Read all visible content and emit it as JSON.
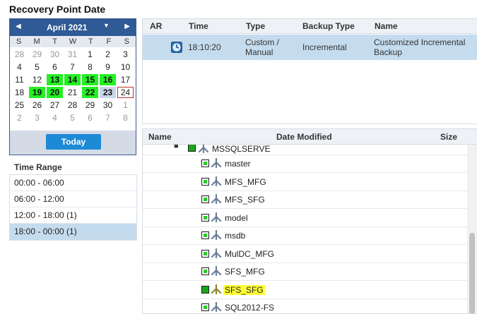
{
  "title": "Recovery Point Date",
  "calendar": {
    "month_label": "April 2021",
    "prev_icon": "chevron-left-icon",
    "next_icon": "chevron-right-icon",
    "weekdays": [
      "S",
      "M",
      "T",
      "W",
      "T",
      "F",
      "S"
    ],
    "days": [
      {
        "d": "28",
        "kind": "other"
      },
      {
        "d": "29",
        "kind": "other"
      },
      {
        "d": "30",
        "kind": "other"
      },
      {
        "d": "31",
        "kind": "other"
      },
      {
        "d": "1",
        "kind": ""
      },
      {
        "d": "2",
        "kind": ""
      },
      {
        "d": "3",
        "kind": ""
      },
      {
        "d": "4",
        "kind": ""
      },
      {
        "d": "5",
        "kind": ""
      },
      {
        "d": "6",
        "kind": ""
      },
      {
        "d": "7",
        "kind": ""
      },
      {
        "d": "8",
        "kind": ""
      },
      {
        "d": "9",
        "kind": ""
      },
      {
        "d": "10",
        "kind": ""
      },
      {
        "d": "11",
        "kind": ""
      },
      {
        "d": "12",
        "kind": ""
      },
      {
        "d": "13",
        "kind": "backup"
      },
      {
        "d": "14",
        "kind": "backup"
      },
      {
        "d": "15",
        "kind": "backup"
      },
      {
        "d": "16",
        "kind": "backup"
      },
      {
        "d": "17",
        "kind": ""
      },
      {
        "d": "18",
        "kind": ""
      },
      {
        "d": "19",
        "kind": "backup"
      },
      {
        "d": "20",
        "kind": "backup"
      },
      {
        "d": "21",
        "kind": ""
      },
      {
        "d": "22",
        "kind": "backup"
      },
      {
        "d": "23",
        "kind": "selected"
      },
      {
        "d": "24",
        "kind": "today"
      },
      {
        "d": "25",
        "kind": ""
      },
      {
        "d": "26",
        "kind": ""
      },
      {
        "d": "27",
        "kind": ""
      },
      {
        "d": "28",
        "kind": ""
      },
      {
        "d": "29",
        "kind": ""
      },
      {
        "d": "30",
        "kind": ""
      },
      {
        "d": "1",
        "kind": "other"
      },
      {
        "d": "2",
        "kind": "other"
      },
      {
        "d": "3",
        "kind": "other"
      },
      {
        "d": "4",
        "kind": "other"
      },
      {
        "d": "5",
        "kind": "other"
      },
      {
        "d": "6",
        "kind": "other"
      },
      {
        "d": "7",
        "kind": "other"
      },
      {
        "d": "8",
        "kind": "other"
      }
    ],
    "today_label": "Today"
  },
  "time_range": {
    "title": "Time Range",
    "items": [
      {
        "label": "00:00 - 06:00",
        "selected": false
      },
      {
        "label": "06:00 - 12:00",
        "selected": false
      },
      {
        "label": "12:00 - 18:00   (1)",
        "selected": false
      },
      {
        "label": "18:00 - 00:00   (1)",
        "selected": true
      }
    ]
  },
  "recovery_points": {
    "columns": {
      "ar": "AR",
      "time": "Time",
      "type": "Type",
      "backup_type": "Backup Type",
      "name": "Name"
    },
    "rows": [
      {
        "icon": "recovery-point-icon",
        "time": "18:10:20",
        "type_line1": "Custom /",
        "type_line2": "Manual",
        "backup_type": "Incremental",
        "name_line1": "Customized Incremental",
        "name_line2": "Backup"
      }
    ]
  },
  "file_tree": {
    "columns": {
      "name": "Name",
      "date_modified": "Date Modified",
      "size": "Size"
    },
    "parent_label": "MSSQLSERVE",
    "items": [
      {
        "label": "master",
        "highlight": false
      },
      {
        "label": "MFS_MFG",
        "highlight": false
      },
      {
        "label": "MFS_SFG",
        "highlight": false
      },
      {
        "label": "model",
        "highlight": false
      },
      {
        "label": "msdb",
        "highlight": false
      },
      {
        "label": "MulDC_MFG",
        "highlight": false
      },
      {
        "label": "SFS_MFG",
        "highlight": false
      },
      {
        "label": "SFS_SFG",
        "highlight": true
      },
      {
        "label": "SQL2012-FS",
        "highlight": false
      }
    ]
  },
  "colors": {
    "calendar_header": "#2f5a95",
    "backup_day": "#25f025",
    "selected_row": "#c5dcee",
    "today_button": "#1d8ad6",
    "highlight": "#ffff33"
  }
}
